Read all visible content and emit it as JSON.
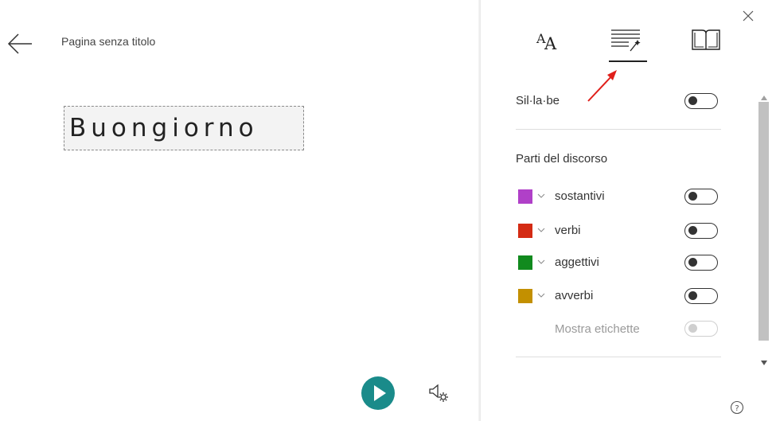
{
  "header": {
    "page_title": "Pagina senza titolo"
  },
  "content": {
    "word": "Buongiorno"
  },
  "panel": {
    "tabs": [
      {
        "name": "text-options",
        "icon": "text-size-icon"
      },
      {
        "name": "grammar-options",
        "icon": "grammar-icon",
        "selected": true
      },
      {
        "name": "reading-preferences",
        "icon": "book-icon"
      }
    ],
    "syllables": {
      "label": "Sil·la·be",
      "on": false
    },
    "parts_heading": "Parti del discorso",
    "parts": [
      {
        "label": "sostantivi",
        "color": "#b040c8",
        "on": false
      },
      {
        "label": "verbi",
        "color": "#d42b14",
        "on": false
      },
      {
        "label": "aggettivi",
        "color": "#118a1e",
        "on": false
      },
      {
        "label": "avverbi",
        "color": "#c39000",
        "on": false
      }
    ],
    "show_labels": {
      "label": "Mostra etichette",
      "on": false,
      "disabled": true
    }
  },
  "colors": {
    "play": "#1a8b8a",
    "annotation_arrow": "#e0201b"
  }
}
